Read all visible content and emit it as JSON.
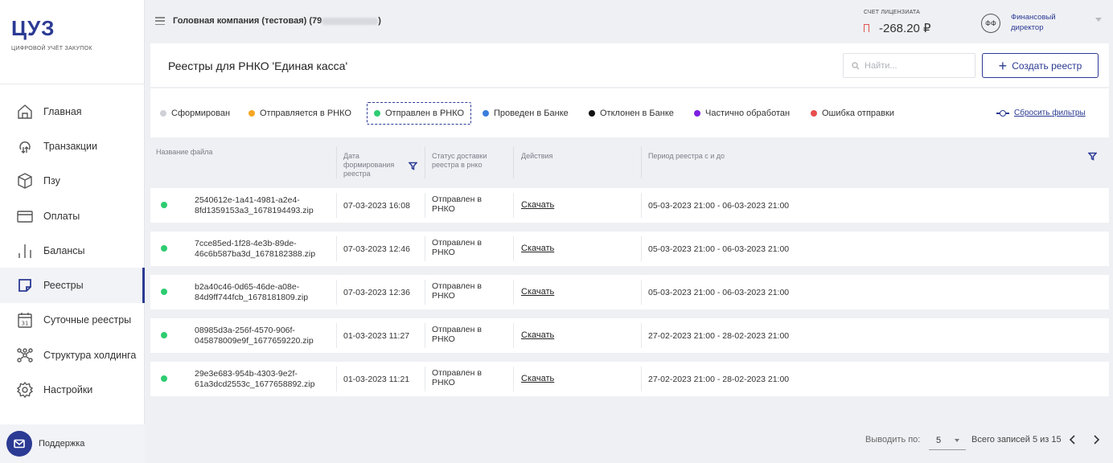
{
  "app": {
    "logo": "ЦУЗ",
    "logo_subtitle": "ЦИФРОВОЙ УЧЁТ ЗАКУПОК"
  },
  "sidebar": {
    "items": [
      {
        "label": "Главная",
        "icon": "home-icon"
      },
      {
        "label": "Транзакции",
        "icon": "transactions-icon"
      },
      {
        "label": "Пзу",
        "icon": "box-icon"
      },
      {
        "label": "Оплаты",
        "icon": "card-icon"
      },
      {
        "label": "Балансы",
        "icon": "bars-icon"
      },
      {
        "label": "Реестры",
        "icon": "registry-icon",
        "active": true
      },
      {
        "label": "Суточные реестры",
        "icon": "calendar-icon"
      },
      {
        "label": "Структура холдинга",
        "icon": "structure-icon"
      },
      {
        "label": "Настройки",
        "icon": "gear-icon"
      }
    ],
    "support_label": "Поддержка"
  },
  "topbar": {
    "company": "Головная компания (тестовая) (79",
    "company_suffix": ")",
    "account_label": "СЧЕТ ЛИЦЕНЗИАТА",
    "account_value": "-268.20 ₽",
    "avatar_initials": "ФФ",
    "role": "Финансовый директор"
  },
  "page": {
    "title": "Реестры для РНКО 'Единая касса'",
    "search_placeholder": "Найти...",
    "create_label": "Создать реестр"
  },
  "filters": {
    "chips": [
      {
        "label": "Сформирован",
        "color": "#cfd1d6"
      },
      {
        "label": "Отправляется в РНКО",
        "color": "#f5a623"
      },
      {
        "label": "Отправлен в РНКО",
        "color": "#2ecc71",
        "selected": true
      },
      {
        "label": "Проведен в Банке",
        "color": "#3b7ddd"
      },
      {
        "label": "Отклонен в Банке",
        "color": "#111111"
      },
      {
        "label": "Частично обработан",
        "color": "#7b1fe0"
      },
      {
        "label": "Ошибка отправки",
        "color": "#e84d4d"
      }
    ],
    "reset_label": "Сбросить фильтры"
  },
  "table": {
    "columns": {
      "file": "Название файла",
      "date_line1": "Дата",
      "date_line2": "формирования",
      "date_line3": "реестра",
      "status_line1": "Статус доставки",
      "status_line2": "реестра в рнко",
      "actions": "Действия",
      "period": "Период реестра с и до"
    },
    "rows": [
      {
        "file1": "2540612e-1a41-4981-a2e4-",
        "file2": "8fd1359153a3_1678194493.zip",
        "date": "07-03-2023 16:08",
        "status1": "Отправлен в",
        "status2": "РНКО",
        "action": "Скачать",
        "period": "05-03-2023 21:00 - 06-03-2023 21:00"
      },
      {
        "file1": "7cce85ed-1f28-4e3b-89de-",
        "file2": "46c6b587ba3d_1678182388.zip",
        "date": "07-03-2023 12:46",
        "status1": "Отправлен в",
        "status2": "РНКО",
        "action": "Скачать",
        "period": "05-03-2023 21:00 - 06-03-2023 21:00"
      },
      {
        "file1": "b2a40c46-0d65-46de-a08e-",
        "file2": "84d9ff744fcb_1678181809.zip",
        "date": "07-03-2023 12:36",
        "status1": "Отправлен в",
        "status2": "РНКО",
        "action": "Скачать",
        "period": "05-03-2023 21:00 - 06-03-2023 21:00"
      },
      {
        "file1": "08985d3a-256f-4570-906f-",
        "file2": "045878009e9f_1677659220.zip",
        "date": "01-03-2023 11:27",
        "status1": "Отправлен в",
        "status2": "РНКО",
        "action": "Скачать",
        "period": "27-02-2023 21:00 - 28-02-2023 21:00"
      },
      {
        "file1": "29e3e683-954b-4303-9e2f-",
        "file2": "61a3dcd2553c_1677658892.zip",
        "date": "01-03-2023 11:21",
        "status1": "Отправлен в",
        "status2": "РНКО",
        "action": "Скачать",
        "period": "27-02-2023 21:00 - 28-02-2023 21:00"
      }
    ]
  },
  "pagination": {
    "per_page_label": "Выводить по:",
    "per_page_value": "5",
    "total_label": "Всего записей 5 из 15"
  }
}
